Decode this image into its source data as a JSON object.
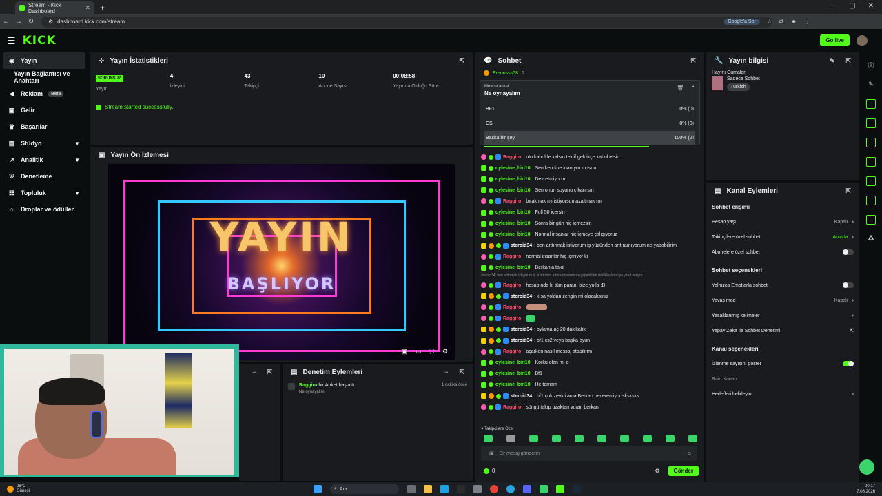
{
  "browser": {
    "tab_title": "Stream - Kick Dashboard",
    "url": "dashboard.kick.com/stream",
    "google_sor": "Google'a Sor"
  },
  "header": {
    "logo": "KICK",
    "golive_label": "Go live"
  },
  "sidebar": {
    "items": [
      {
        "label": "Yayın"
      },
      {
        "label": "Yayın Bağlantısı ve Anahtarı"
      },
      {
        "label": "Reklam",
        "badge": "Beta"
      },
      {
        "label": "Gelir"
      },
      {
        "label": "Başarılar"
      },
      {
        "label": "Stüdyo"
      },
      {
        "label": "Analitik"
      },
      {
        "label": "Denetleme"
      },
      {
        "label": "Topluluk"
      },
      {
        "label": "Droplar ve ödüller"
      }
    ]
  },
  "stats": {
    "title": "Yayın İstatistikleri",
    "status_badge": "SORUNSUZ",
    "items": [
      {
        "value": "",
        "label": "Yayın"
      },
      {
        "value": "4",
        "label": "İzleyici"
      },
      {
        "value": "43",
        "label": "Takipçi"
      },
      {
        "value": "10",
        "label": "Abone Sayısı"
      },
      {
        "value": "00:08:58",
        "label": "Yayında Olduğu Süre"
      }
    ],
    "success": "Stream started successfully."
  },
  "preview": {
    "title": "Yayın Ön İzlemesi",
    "overlay_top": "YAYIN",
    "overlay_bottom": "BAŞLIYOR"
  },
  "moderation": {
    "title": "Denetim Eylemleri",
    "user": "Raggiro",
    "action": "bir Anket başlattı",
    "sub": "Ne oynayalım",
    "time": "1 dakika önce"
  },
  "chat": {
    "title": "Sohbet",
    "pinned_user": "Erennsss58",
    "pinned_count": "1",
    "poll": {
      "tag": "Mevcut anket",
      "question": "Ne oynayalım",
      "options": [
        {
          "name": "BF1",
          "result": "0% (0)"
        },
        {
          "name": "CS",
          "result": "0% (0)"
        },
        {
          "name": "Başka bir şey",
          "result": "100% (2)"
        }
      ]
    },
    "messages": [
      {
        "user": "Raggiro",
        "color": "red",
        "badges": [
          "pink",
          "spark",
          "blue"
        ],
        "text": ": oto kabulde kalsın teklif geldikçe kabul etsin"
      },
      {
        "user": "oylesine_biri10",
        "color": "green",
        "badges": [
          "green",
          "spark"
        ],
        "text": ": Sen kendine inanıyor musun"
      },
      {
        "user": "oylesine_biri10",
        "color": "green",
        "badges": [
          "green",
          "spark"
        ],
        "text": ": Devretmiyorrrr"
      },
      {
        "user": "oylesine_biri10",
        "color": "green",
        "badges": [
          "green",
          "spark"
        ],
        "text": ": Sen onun suyunu çıkarırsın"
      },
      {
        "user": "Raggiro",
        "color": "red",
        "badges": [
          "pink",
          "spark",
          "blue"
        ],
        "text": ": bırakmak mı istiyorsun azaltmak mı"
      },
      {
        "user": "oylesine_biri10",
        "color": "green",
        "badges": [
          "green",
          "spark"
        ],
        "text": ": Full 50 içersin"
      },
      {
        "user": "oylesine_biri10",
        "color": "green",
        "badges": [
          "green",
          "spark"
        ],
        "text": ": Sonra bir gün hiç içmezsin"
      },
      {
        "user": "oylesine_biri10",
        "color": "green",
        "badges": [
          "green",
          "spark"
        ],
        "text": ": Normal insanlar hiç içmeye çalışıyoruz"
      },
      {
        "user": "steroid34",
        "color": "white",
        "badges": [
          "yellow",
          "orange",
          "spark",
          "blue"
        ],
        "text": ": ben arttırmak istiyorum iş yüzünden arttıramıyorum ne yapabilirim"
      },
      {
        "user": "Raggiro",
        "color": "red",
        "badges": [
          "pink",
          "spark",
          "blue"
        ],
        "text": ": normal insanlar hiç içmiyor ki"
      },
      {
        "user": "oylesine_biri10",
        "color": "green",
        "badges": [
          "green",
          "spark"
        ],
        "text": ": Berkanla takıl"
      },
      {
        "reply": "steroid34: ben arttırmak istiyorum iş yüzünden arttıramıyorum ne yapabilirim isimli kullanıcıya yanıt veriyor"
      },
      {
        "user": "Raggiro",
        "color": "red",
        "badges": [
          "pink",
          "spark",
          "blue"
        ],
        "text": ": hesabında ki tüm paranı bize yolla :D"
      },
      {
        "user": "steroid34",
        "color": "white",
        "badges": [
          "yellow",
          "orange",
          "spark",
          "blue"
        ],
        "text": ": kısa yoldan zengin mi olacaksınız"
      },
      {
        "user": "Raggiro",
        "color": "red",
        "badges": [
          "pink",
          "spark",
          "blue"
        ],
        "text": ":",
        "emote": "hand"
      },
      {
        "user": "Raggiro",
        "color": "red",
        "badges": [
          "pink",
          "spark",
          "blue"
        ],
        "text": ":",
        "emote": "green"
      },
      {
        "user": "steroid34",
        "color": "white",
        "badges": [
          "yellow",
          "orange",
          "spark",
          "blue"
        ],
        "text": ": oylama aç 20 dakikalık"
      },
      {
        "user": "steroid34",
        "color": "white",
        "badges": [
          "yellow",
          "orange",
          "spark",
          "blue"
        ],
        "text": ": bf1 cs2 veya başka oyun"
      },
      {
        "user": "Raggiro",
        "color": "red",
        "badges": [
          "pink",
          "spark",
          "blue"
        ],
        "text": ": açarken nasıl messaj atabilirim"
      },
      {
        "user": "oylesine_biri10",
        "color": "green",
        "badges": [
          "green",
          "spark"
        ],
        "text": ": Korku olan mı o"
      },
      {
        "user": "oylesine_biri10",
        "color": "green",
        "badges": [
          "green",
          "spark"
        ],
        "text": ": Bf1"
      },
      {
        "user": "oylesine_biri10",
        "color": "green",
        "badges": [
          "green",
          "spark"
        ],
        "text": ": He tamam"
      },
      {
        "user": "steroid34",
        "color": "white",
        "badges": [
          "yellow",
          "orange",
          "spark",
          "blue"
        ],
        "text": ": bf1 çok zevkli ama Berkan beceremiyor sksksks"
      },
      {
        "user": "Raggiro",
        "color": "red",
        "badges": [
          "pink",
          "spark",
          "blue"
        ],
        "text": ": süngü takıp uzaktan vuran berkan"
      }
    ],
    "followers_only": "Takipçilere Özel",
    "input_placeholder": "Bir mesaj gönderin",
    "points": "0",
    "send": "Gönder"
  },
  "stream_info": {
    "title": "Yayın bilgisi",
    "stream_title": "Hayırlı Cumalar",
    "category": "Sadece Sohbet",
    "language": "Turkish"
  },
  "channel_actions": {
    "title": "Kanal Eylemleri",
    "chat_access": "Sohbet erişimi",
    "rows1": [
      {
        "label": "Hesap yaşı",
        "value": "Kapalı"
      },
      {
        "label": "Takipçilere özel sohbet",
        "value": "Anında"
      },
      {
        "label": "Abonelere özel sohbet",
        "value": ""
      }
    ],
    "chat_options": "Sohbet seçenekleri",
    "rows2": [
      {
        "label": "Yalnızca Emotlarla sohbet",
        "value": ""
      },
      {
        "label": "Yavaş mod",
        "value": "Kapalı"
      },
      {
        "label": "Yasaklanmış kelimeler",
        "value": ""
      },
      {
        "label": "Yapay Zeka ile Sohbet Denetimi",
        "value": ""
      }
    ],
    "channel_options": "Kanal seçenekleri",
    "rows3": [
      {
        "label": "İzlenme sayısını göster",
        "value": ""
      },
      {
        "label": "Raid Kanalı",
        "value": ""
      },
      {
        "label": "Hedefleri belirleyin",
        "value": ""
      }
    ]
  },
  "taskbar": {
    "temp": "28°C",
    "weather": "Güneşli",
    "search": "Ara",
    "time": "20:17",
    "date": "7.08.2026"
  }
}
